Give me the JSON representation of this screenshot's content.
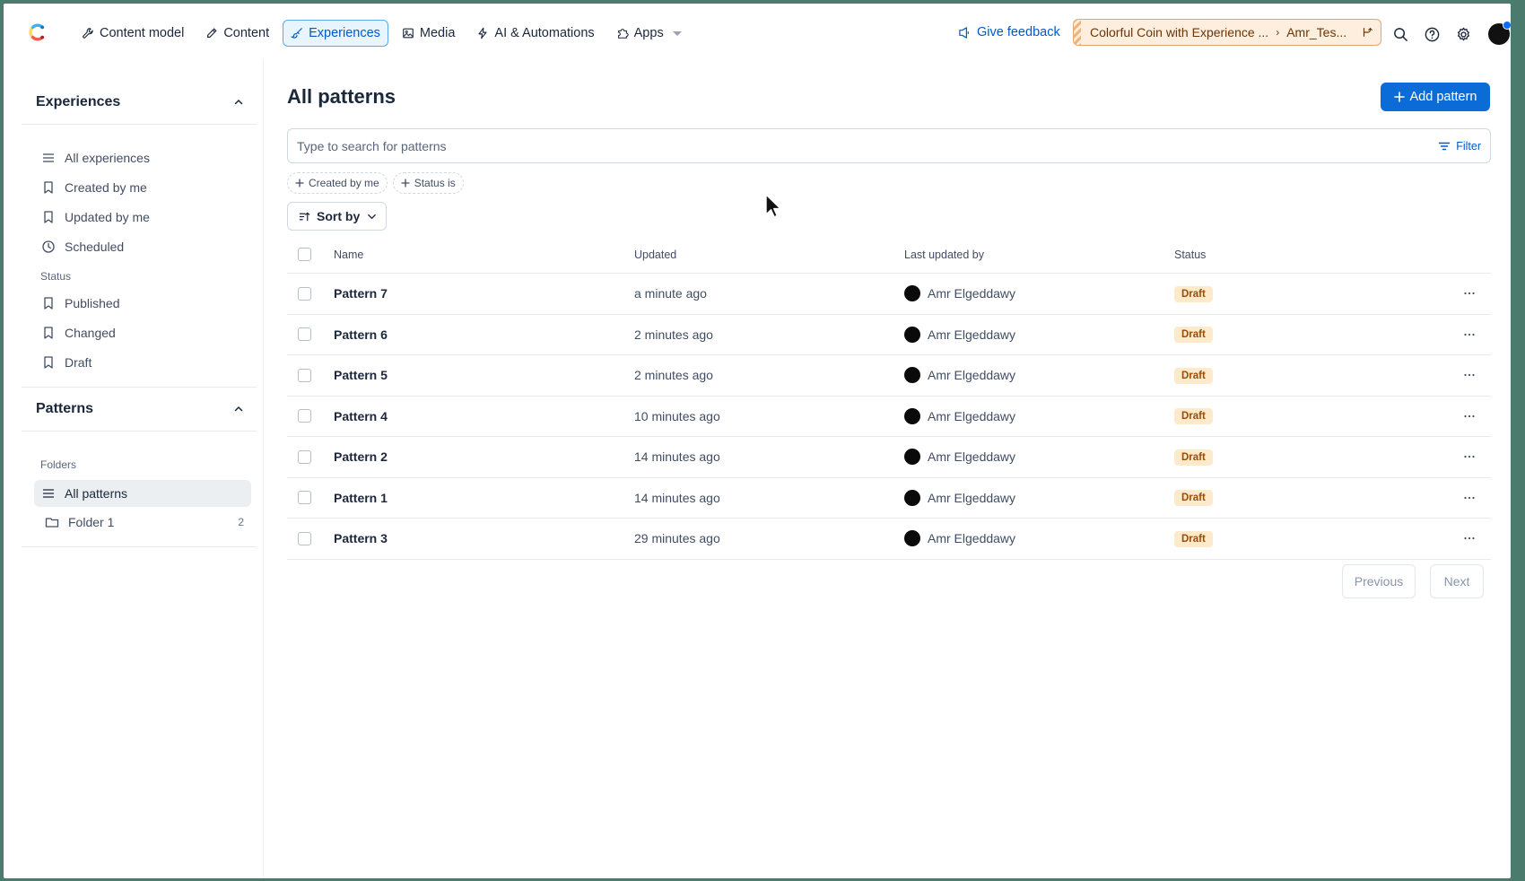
{
  "nav": {
    "items": [
      {
        "label": "Content model",
        "icon": "wrench-icon"
      },
      {
        "label": "Content",
        "icon": "pen-icon"
      },
      {
        "label": "Experiences",
        "icon": "brush-icon",
        "active": true
      },
      {
        "label": "Media",
        "icon": "image-icon"
      },
      {
        "label": "AI & Automations",
        "icon": "lightning-icon"
      },
      {
        "label": "Apps",
        "icon": "puzzle-icon"
      }
    ],
    "feedback_label": "Give feedback",
    "env_space": "Colorful Coin with Experience ...",
    "env_name": "Amr_Tes..."
  },
  "sidebar": {
    "experiences_title": "Experiences",
    "experience_items": [
      {
        "label": "All experiences",
        "icon": "list-icon"
      },
      {
        "label": "Created by me",
        "icon": "bookmark-icon"
      },
      {
        "label": "Updated by me",
        "icon": "bookmark-icon"
      },
      {
        "label": "Scheduled",
        "icon": "clock-icon"
      }
    ],
    "status_label": "Status",
    "status_items": [
      {
        "label": "Published",
        "icon": "bookmark-icon"
      },
      {
        "label": "Changed",
        "icon": "bookmark-icon"
      },
      {
        "label": "Draft",
        "icon": "bookmark-icon"
      }
    ],
    "patterns_title": "Patterns",
    "folders_label": "Folders",
    "pattern_items": [
      {
        "label": "All patterns",
        "icon": "list-icon",
        "active": true,
        "count": ""
      },
      {
        "label": "Folder 1",
        "icon": "folder-icon",
        "active": false,
        "count": "2"
      }
    ]
  },
  "main": {
    "title": "All patterns",
    "add_label": "Add pattern",
    "search_placeholder": "Type to search for patterns",
    "filter_label": "Filter",
    "chips": [
      "Created by me",
      "Status is"
    ],
    "sort_label": "Sort by",
    "columns": {
      "name": "Name",
      "updated": "Updated",
      "by": "Last updated by",
      "status": "Status"
    },
    "rows": [
      {
        "name": "Pattern 7",
        "updated": "a minute ago",
        "by": "Amr Elgeddawy",
        "status": "Draft"
      },
      {
        "name": "Pattern 6",
        "updated": "2 minutes ago",
        "by": "Amr Elgeddawy",
        "status": "Draft"
      },
      {
        "name": "Pattern 5",
        "updated": "2 minutes ago",
        "by": "Amr Elgeddawy",
        "status": "Draft"
      },
      {
        "name": "Pattern 4",
        "updated": "10 minutes ago",
        "by": "Amr Elgeddawy",
        "status": "Draft"
      },
      {
        "name": "Pattern 2",
        "updated": "14 minutes ago",
        "by": "Amr Elgeddawy",
        "status": "Draft"
      },
      {
        "name": "Pattern 1",
        "updated": "14 minutes ago",
        "by": "Amr Elgeddawy",
        "status": "Draft"
      },
      {
        "name": "Pattern 3",
        "updated": "29 minutes ago",
        "by": "Amr Elgeddawy",
        "status": "Draft"
      }
    ],
    "prev_label": "Previous",
    "next_label": "Next"
  },
  "colors": {
    "primary": "#0b6cd8",
    "accent_link": "#0059c8",
    "draft_badge": "#fdeacb",
    "env_badge": "#fdeedd"
  }
}
